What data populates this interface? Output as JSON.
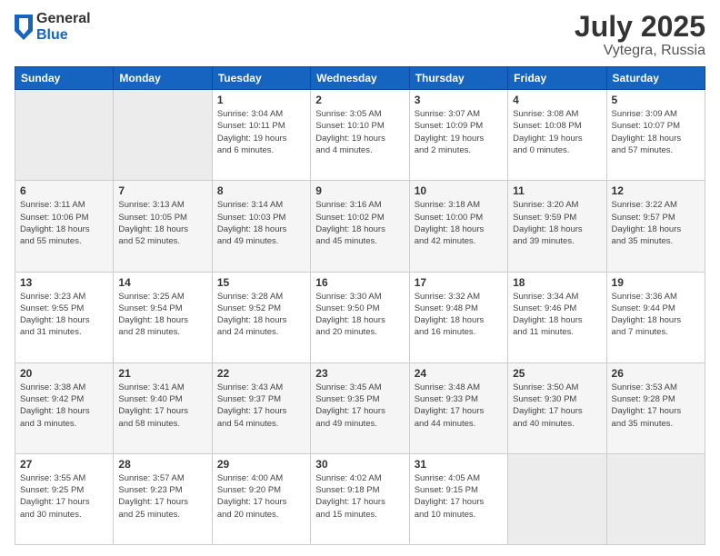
{
  "header": {
    "logo_general": "General",
    "logo_blue": "Blue",
    "month_year": "July 2025",
    "location": "Vytegra, Russia"
  },
  "weekdays": [
    "Sunday",
    "Monday",
    "Tuesday",
    "Wednesday",
    "Thursday",
    "Friday",
    "Saturday"
  ],
  "weeks": [
    [
      {
        "day": "",
        "detail": ""
      },
      {
        "day": "",
        "detail": ""
      },
      {
        "day": "1",
        "detail": "Sunrise: 3:04 AM\nSunset: 10:11 PM\nDaylight: 19 hours\nand 6 minutes."
      },
      {
        "day": "2",
        "detail": "Sunrise: 3:05 AM\nSunset: 10:10 PM\nDaylight: 19 hours\nand 4 minutes."
      },
      {
        "day": "3",
        "detail": "Sunrise: 3:07 AM\nSunset: 10:09 PM\nDaylight: 19 hours\nand 2 minutes."
      },
      {
        "day": "4",
        "detail": "Sunrise: 3:08 AM\nSunset: 10:08 PM\nDaylight: 19 hours\nand 0 minutes."
      },
      {
        "day": "5",
        "detail": "Sunrise: 3:09 AM\nSunset: 10:07 PM\nDaylight: 18 hours\nand 57 minutes."
      }
    ],
    [
      {
        "day": "6",
        "detail": "Sunrise: 3:11 AM\nSunset: 10:06 PM\nDaylight: 18 hours\nand 55 minutes."
      },
      {
        "day": "7",
        "detail": "Sunrise: 3:13 AM\nSunset: 10:05 PM\nDaylight: 18 hours\nand 52 minutes."
      },
      {
        "day": "8",
        "detail": "Sunrise: 3:14 AM\nSunset: 10:03 PM\nDaylight: 18 hours\nand 49 minutes."
      },
      {
        "day": "9",
        "detail": "Sunrise: 3:16 AM\nSunset: 10:02 PM\nDaylight: 18 hours\nand 45 minutes."
      },
      {
        "day": "10",
        "detail": "Sunrise: 3:18 AM\nSunset: 10:00 PM\nDaylight: 18 hours\nand 42 minutes."
      },
      {
        "day": "11",
        "detail": "Sunrise: 3:20 AM\nSunset: 9:59 PM\nDaylight: 18 hours\nand 39 minutes."
      },
      {
        "day": "12",
        "detail": "Sunrise: 3:22 AM\nSunset: 9:57 PM\nDaylight: 18 hours\nand 35 minutes."
      }
    ],
    [
      {
        "day": "13",
        "detail": "Sunrise: 3:23 AM\nSunset: 9:55 PM\nDaylight: 18 hours\nand 31 minutes."
      },
      {
        "day": "14",
        "detail": "Sunrise: 3:25 AM\nSunset: 9:54 PM\nDaylight: 18 hours\nand 28 minutes."
      },
      {
        "day": "15",
        "detail": "Sunrise: 3:28 AM\nSunset: 9:52 PM\nDaylight: 18 hours\nand 24 minutes."
      },
      {
        "day": "16",
        "detail": "Sunrise: 3:30 AM\nSunset: 9:50 PM\nDaylight: 18 hours\nand 20 minutes."
      },
      {
        "day": "17",
        "detail": "Sunrise: 3:32 AM\nSunset: 9:48 PM\nDaylight: 18 hours\nand 16 minutes."
      },
      {
        "day": "18",
        "detail": "Sunrise: 3:34 AM\nSunset: 9:46 PM\nDaylight: 18 hours\nand 11 minutes."
      },
      {
        "day": "19",
        "detail": "Sunrise: 3:36 AM\nSunset: 9:44 PM\nDaylight: 18 hours\nand 7 minutes."
      }
    ],
    [
      {
        "day": "20",
        "detail": "Sunrise: 3:38 AM\nSunset: 9:42 PM\nDaylight: 18 hours\nand 3 minutes."
      },
      {
        "day": "21",
        "detail": "Sunrise: 3:41 AM\nSunset: 9:40 PM\nDaylight: 17 hours\nand 58 minutes."
      },
      {
        "day": "22",
        "detail": "Sunrise: 3:43 AM\nSunset: 9:37 PM\nDaylight: 17 hours\nand 54 minutes."
      },
      {
        "day": "23",
        "detail": "Sunrise: 3:45 AM\nSunset: 9:35 PM\nDaylight: 17 hours\nand 49 minutes."
      },
      {
        "day": "24",
        "detail": "Sunrise: 3:48 AM\nSunset: 9:33 PM\nDaylight: 17 hours\nand 44 minutes."
      },
      {
        "day": "25",
        "detail": "Sunrise: 3:50 AM\nSunset: 9:30 PM\nDaylight: 17 hours\nand 40 minutes."
      },
      {
        "day": "26",
        "detail": "Sunrise: 3:53 AM\nSunset: 9:28 PM\nDaylight: 17 hours\nand 35 minutes."
      }
    ],
    [
      {
        "day": "27",
        "detail": "Sunrise: 3:55 AM\nSunset: 9:25 PM\nDaylight: 17 hours\nand 30 minutes."
      },
      {
        "day": "28",
        "detail": "Sunrise: 3:57 AM\nSunset: 9:23 PM\nDaylight: 17 hours\nand 25 minutes."
      },
      {
        "day": "29",
        "detail": "Sunrise: 4:00 AM\nSunset: 9:20 PM\nDaylight: 17 hours\nand 20 minutes."
      },
      {
        "day": "30",
        "detail": "Sunrise: 4:02 AM\nSunset: 9:18 PM\nDaylight: 17 hours\nand 15 minutes."
      },
      {
        "day": "31",
        "detail": "Sunrise: 4:05 AM\nSunset: 9:15 PM\nDaylight: 17 hours\nand 10 minutes."
      },
      {
        "day": "",
        "detail": ""
      },
      {
        "day": "",
        "detail": ""
      }
    ]
  ]
}
